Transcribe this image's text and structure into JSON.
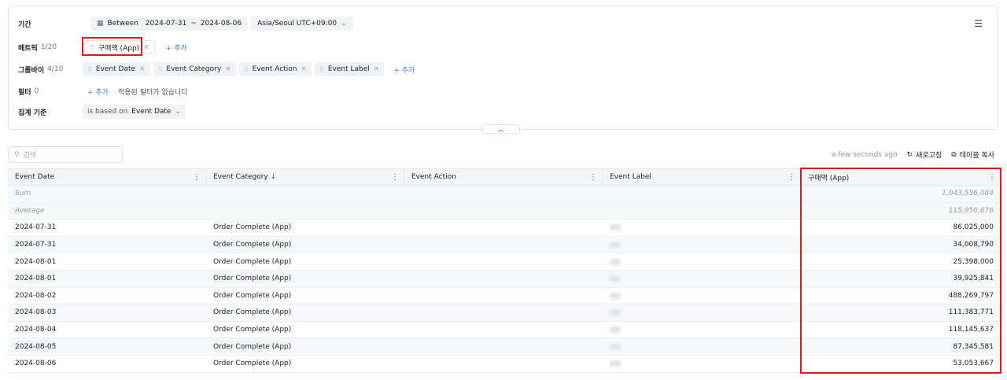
{
  "panel": {
    "period": {
      "label": "기간",
      "mode": "Between",
      "start": "2024-07-31",
      "sep": "~",
      "end": "2024-08-06",
      "timezone": "Asia/Seoul UTC+09:00"
    },
    "metric": {
      "label": "메트릭",
      "count": "1/20",
      "chip": "구매액 (App)",
      "add": "+ 추가"
    },
    "groupby": {
      "label": "그룹바이",
      "count": "4/10",
      "chips": [
        "Event Date",
        "Event Category",
        "Event Action",
        "Event Label"
      ],
      "add": "+ 추가"
    },
    "filter": {
      "label": "필터",
      "count": "0",
      "add": "+ 추가",
      "empty": "적용된 필터가 없습니다"
    },
    "aggregate": {
      "label": "집계 기준",
      "prefix": "is based on",
      "value": "Event Date"
    }
  },
  "toolbar": {
    "search_placeholder": "검색",
    "updated": "a few seconds ago",
    "refresh": "새로고침",
    "copy": "테이블 복사"
  },
  "table": {
    "columns": [
      "Event Date",
      "Event Category",
      "Event Action",
      "Event Label",
      "구매액 (App)"
    ],
    "sum_label": "Sum",
    "sum_value": "1,043,556,084",
    "avg_label": "Average",
    "avg_value": "115,950,676",
    "rows": [
      {
        "date": "2024-07-31",
        "category": "Order Complete (App)",
        "value": "86,025,000"
      },
      {
        "date": "2024-07-31",
        "category": "Order Complete (App)",
        "value": "34,008,790"
      },
      {
        "date": "2024-08-01",
        "category": "Order Complete (App)",
        "value": "25,398,000"
      },
      {
        "date": "2024-08-01",
        "category": "Order Complete (App)",
        "value": "39,925,841"
      },
      {
        "date": "2024-08-02",
        "category": "Order Complete (App)",
        "value": "488,269,797"
      },
      {
        "date": "2024-08-03",
        "category": "Order Complete (App)",
        "value": "111,383,771"
      },
      {
        "date": "2024-08-04",
        "category": "Order Complete (App)",
        "value": "118,145,637"
      },
      {
        "date": "2024-08-05",
        "category": "Order Complete (App)",
        "value": "87,345,581"
      },
      {
        "date": "2024-08-06",
        "category": "Order Complete (App)",
        "value": "53,053,667"
      }
    ]
  },
  "colors": {
    "accent": "#3b82f6",
    "highlight": "#d21f1f",
    "sort_arrow": "#1f5fd6"
  }
}
